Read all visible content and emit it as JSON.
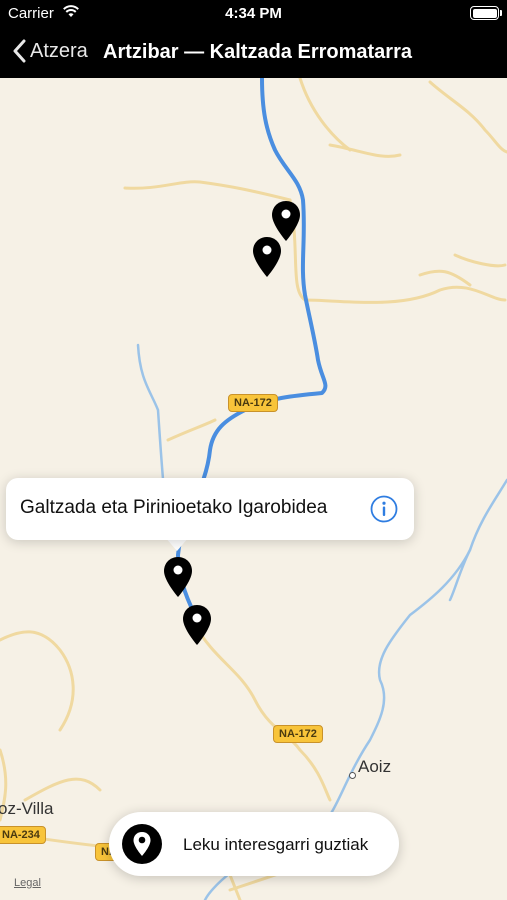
{
  "status_bar": {
    "carrier": "Carrier",
    "time": "4:34 PM"
  },
  "nav": {
    "back_label": "Atzera",
    "title": "Artzibar — Kaltzada Erromatarra"
  },
  "map": {
    "road_labels": [
      "NA-172",
      "NA-172",
      "NA-234",
      "NA"
    ],
    "towns": [
      "Aoiz",
      "oz-Villa"
    ],
    "legal": "Legal"
  },
  "callout": {
    "title": "Galtzada eta Pirinioetako Igarobidea"
  },
  "poi_button": {
    "label": "Leku interesgarri guztiak"
  },
  "colors": {
    "route": "#4a8ee0",
    "river": "#9bc3e8",
    "road": "#f0d9a0",
    "info": "#2f7de1"
  }
}
